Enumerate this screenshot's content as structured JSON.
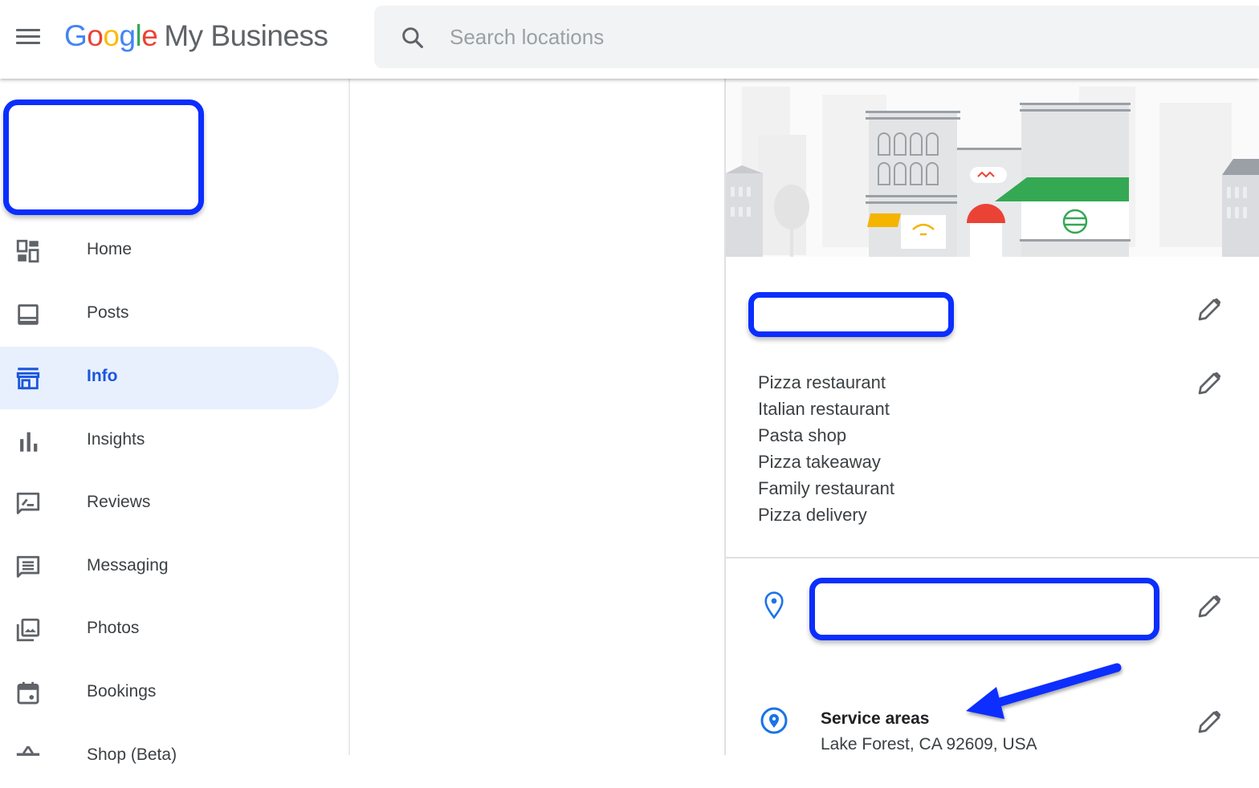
{
  "header": {
    "brand_google": [
      "G",
      "o",
      "o",
      "g",
      "l",
      "e"
    ],
    "brand_product": "My Business",
    "search_placeholder": "Search locations",
    "search_value": ""
  },
  "sidebar": {
    "items": [
      {
        "label": "Home",
        "icon": "dashboard-icon",
        "active": false
      },
      {
        "label": "Posts",
        "icon": "posts-icon",
        "active": false
      },
      {
        "label": "Info",
        "icon": "storefront-icon",
        "active": true
      },
      {
        "label": "Insights",
        "icon": "bar-chart-icon",
        "active": false
      },
      {
        "label": "Reviews",
        "icon": "rate-review-icon",
        "active": false
      },
      {
        "label": "Messaging",
        "icon": "message-icon",
        "active": false
      },
      {
        "label": "Photos",
        "icon": "photo-library-icon",
        "active": false
      },
      {
        "label": "Bookings",
        "icon": "calendar-event-icon",
        "active": false
      },
      {
        "label": "Shop (Beta)",
        "icon": "shop-icon",
        "active": false
      }
    ]
  },
  "info_panel": {
    "categories": [
      "Pizza restaurant",
      "Italian restaurant",
      "Pasta shop",
      "Pizza takeaway",
      "Family restaurant",
      "Pizza delivery"
    ],
    "service_areas": {
      "title": "Service areas",
      "value": "Lake Forest, CA 92609, USA"
    }
  },
  "colors": {
    "accent": "#1a73e8",
    "highlight_annotation": "#0a2eff",
    "active_nav_bg": "#e8f0fe"
  }
}
